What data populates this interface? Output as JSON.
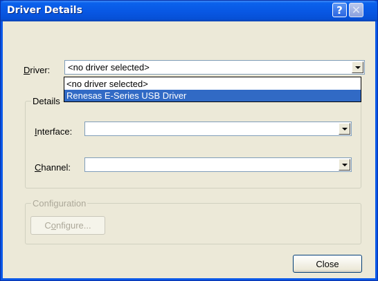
{
  "window": {
    "title": "Driver Details",
    "help_glyph": "?",
    "close_glyph": "✕"
  },
  "driver": {
    "label_accel": "D",
    "label_rest": "river:",
    "selected": "<no driver selected>",
    "options": [
      "<no driver selected>",
      "Renesas E-Series USB Driver"
    ],
    "highlighted_option": "Renesas E-Series USB Driver"
  },
  "details": {
    "legend": "Details",
    "interface_label_accel": "I",
    "interface_label_rest": "nterface:",
    "interface_value": "",
    "channel_label_accel": "C",
    "channel_label_rest": "hannel:",
    "channel_value": ""
  },
  "configuration": {
    "legend": "Configuration",
    "configure_button_accel": "o",
    "configure_button_pre": "C",
    "configure_button_post": "nfigure..."
  },
  "close_button": "Close",
  "colors": {
    "titlebar": "#0a58e8",
    "selection": "#316ac5",
    "face": "#ece9d8"
  }
}
